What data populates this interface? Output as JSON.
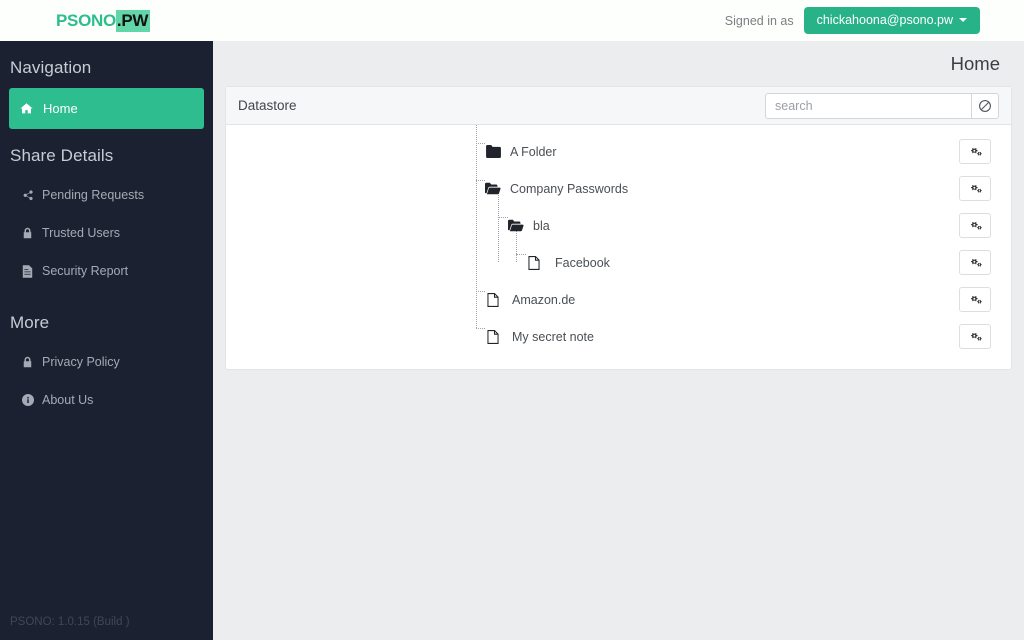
{
  "header": {
    "brand_primary": "PSONO",
    "brand_secondary": ".PW",
    "signed_in_label": "Signed in as",
    "user_email": "chickahoona@psono.pw",
    "brand_color": "#2dbd8f",
    "user_button_color": "#27b387"
  },
  "sidebar": {
    "nav_heading": "Navigation",
    "share_heading": "Share Details",
    "more_heading": "More",
    "version": "PSONO: 1.0.15 (Build )",
    "nav_items": [
      {
        "label": "Home",
        "icon": "home-icon",
        "active": true
      }
    ],
    "share_items": [
      {
        "label": "Pending Requests",
        "icon": "share-alt-icon"
      },
      {
        "label": "Trusted Users",
        "icon": "lock-icon"
      },
      {
        "label": "Security Report",
        "icon": "file-text-icon"
      }
    ],
    "more_items": [
      {
        "label": "Privacy Policy",
        "icon": "lock-icon"
      },
      {
        "label": "About Us",
        "icon": "info-circle-icon"
      }
    ]
  },
  "main": {
    "page_title": "Home",
    "panel_title": "Datastore",
    "search": {
      "placeholder": "search",
      "value": "",
      "clear_icon": "ban-icon"
    },
    "row_action_icon": "cogs-icon",
    "tree": [
      {
        "label": "A Folder",
        "icon": "folder-closed-icon",
        "depth": 0
      },
      {
        "label": "Company Passwords",
        "icon": "folder-open-icon",
        "depth": 0
      },
      {
        "label": "bla",
        "icon": "folder-open-icon",
        "depth": 1
      },
      {
        "label": "Facebook",
        "icon": "file-icon",
        "depth": 2
      },
      {
        "label": "Amazon.de",
        "icon": "file-icon",
        "depth": 0
      },
      {
        "label": "My secret note",
        "icon": "file-icon",
        "depth": 0
      }
    ]
  }
}
